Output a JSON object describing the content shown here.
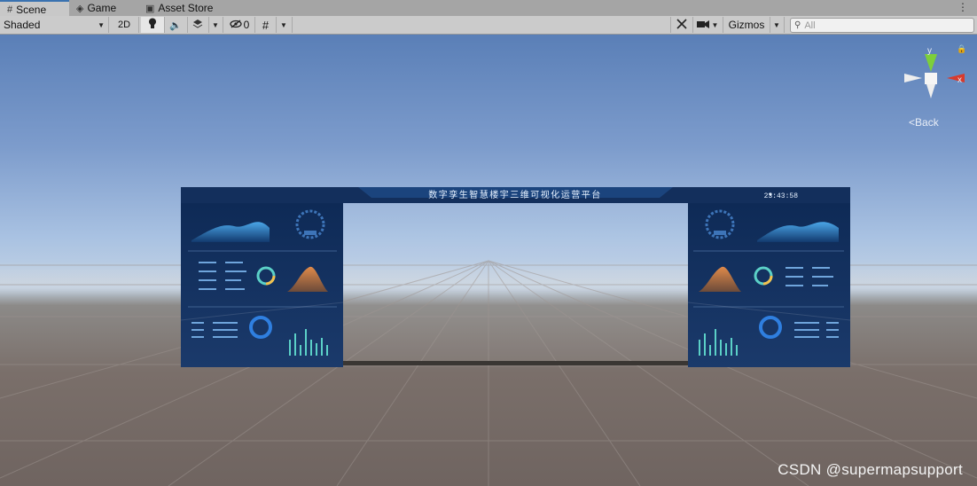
{
  "tabs": [
    {
      "label": "Scene",
      "icon": "scene-grid-icon"
    },
    {
      "label": "Game",
      "icon": "gamepad-icon"
    },
    {
      "label": "Asset Store",
      "icon": "shopping-bag-icon"
    }
  ],
  "toolbar": {
    "shading_mode": "Shaded",
    "mode_2d": "2D",
    "hidden_count": "0",
    "gizmos_label": "Gizmos",
    "search_placeholder": "All"
  },
  "gizmo": {
    "axis_x": "x",
    "axis_y": "y",
    "back_label": "Back"
  },
  "dashboard": {
    "title": "数字孪生智慧楼宇三维可视化运营平台",
    "time": "23:43:58"
  },
  "watermark": "CSDN @supermapsupport",
  "colors": {
    "tab_active_accent": "#3a72b0",
    "sky_top": "#5a7fb7",
    "ground": "#7a6f6a",
    "axis_x": "#d83a2c",
    "axis_y": "#7dcf3a"
  }
}
